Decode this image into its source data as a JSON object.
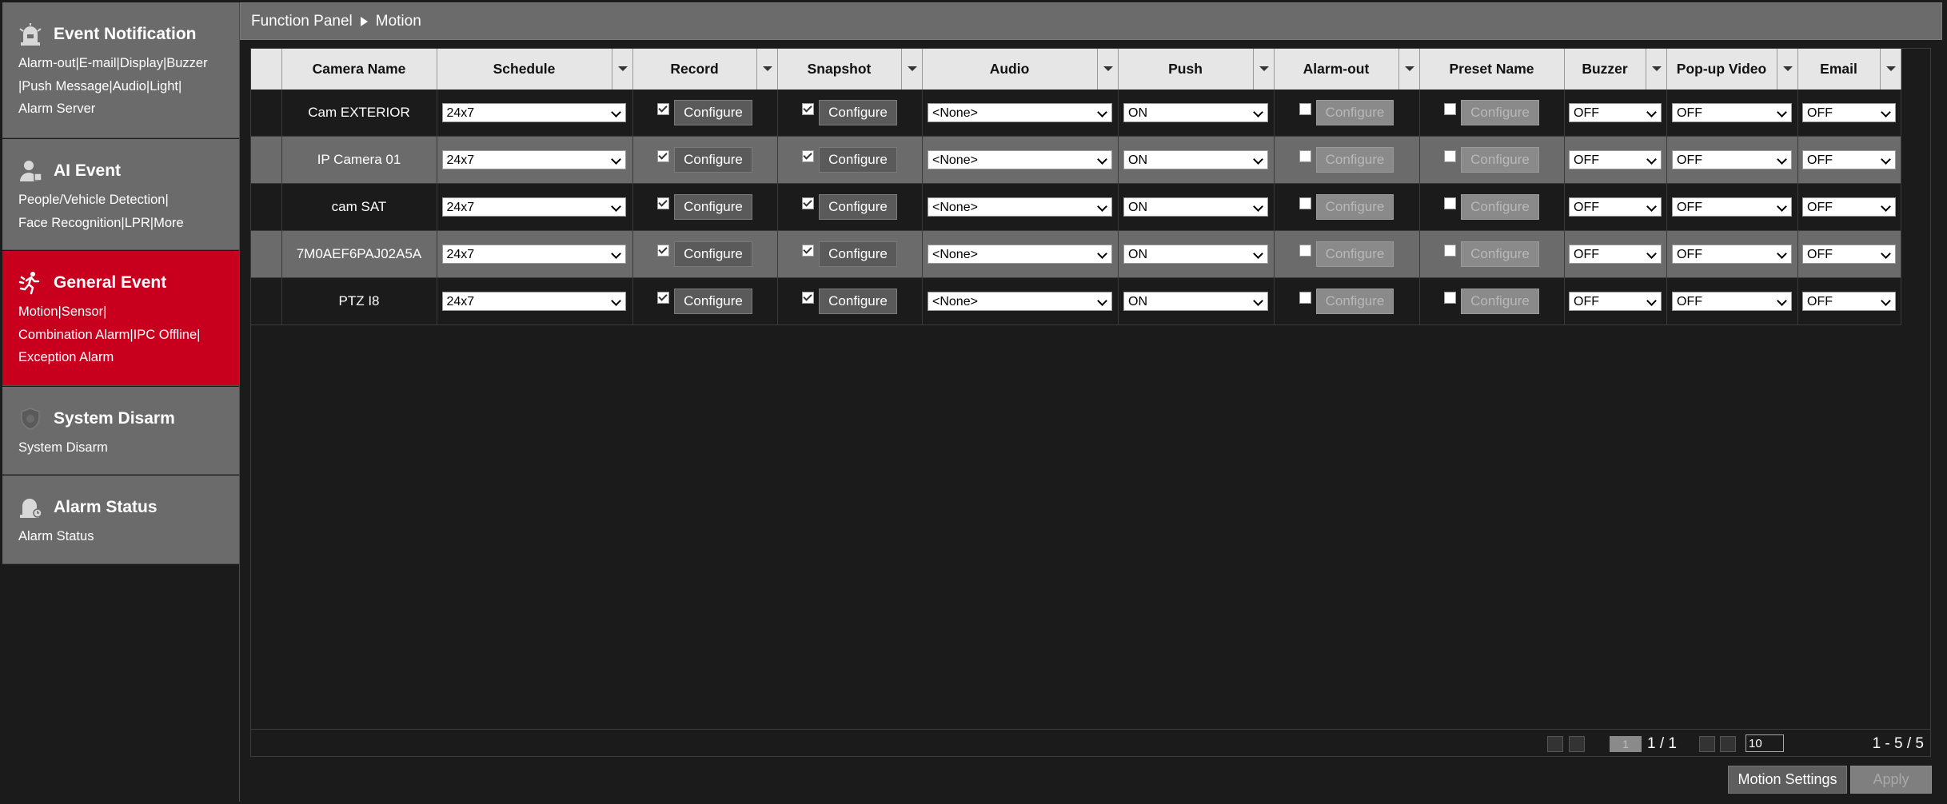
{
  "sidebar": {
    "sections": [
      {
        "title": "Event Notification",
        "links": [
          "Alarm-out|E-mail|Display|Buzzer",
          "|Push Message|Audio|Light|",
          "Alarm Server"
        ],
        "icon": "alarm-bell-icon"
      },
      {
        "title": "AI Event",
        "links": [
          "People/Vehicle Detection|",
          "Face Recognition|LPR|More"
        ],
        "icon": "ai-person-icon"
      },
      {
        "title": "General Event",
        "links": [
          "Motion|Sensor|",
          "Combination Alarm|IPC Offline|",
          "Exception Alarm"
        ],
        "icon": "running-person-icon",
        "active": true
      },
      {
        "title": "System Disarm",
        "links": [
          "System Disarm"
        ],
        "icon": "shield-icon"
      },
      {
        "title": "Alarm Status",
        "links": [
          "Alarm Status"
        ],
        "icon": "alarm-status-icon"
      }
    ],
    "active_color": "#c8001e"
  },
  "breadcrumb": {
    "root": "Function Panel",
    "current": "Motion"
  },
  "table": {
    "columns": [
      "Camera Name",
      "Schedule",
      "Record",
      "Snapshot",
      "Audio",
      "Push",
      "Alarm-out",
      "Preset Name",
      "Buzzer",
      "Pop-up Video",
      "Email"
    ],
    "configure_label": "Configure",
    "rows": [
      {
        "camera": "Cam EXTERIOR",
        "schedule": "24x7",
        "record": true,
        "snapshot": true,
        "audio": "<None>",
        "push": "ON",
        "alarm_out": false,
        "preset": false,
        "buzzer": "OFF",
        "popup": "OFF",
        "email": "OFF"
      },
      {
        "camera": "IP Camera 01",
        "schedule": "24x7",
        "record": true,
        "snapshot": true,
        "audio": "<None>",
        "push": "ON",
        "alarm_out": false,
        "preset": false,
        "buzzer": "OFF",
        "popup": "OFF",
        "email": "OFF"
      },
      {
        "camera": "cam SAT",
        "schedule": "24x7",
        "record": true,
        "snapshot": true,
        "audio": "<None>",
        "push": "ON",
        "alarm_out": false,
        "preset": false,
        "buzzer": "OFF",
        "popup": "OFF",
        "email": "OFF"
      },
      {
        "camera": "7M0AEF6PAJ02A5A",
        "schedule": "24x7",
        "record": true,
        "snapshot": true,
        "audio": "<None>",
        "push": "ON",
        "alarm_out": false,
        "preset": false,
        "buzzer": "OFF",
        "popup": "OFF",
        "email": "OFF"
      },
      {
        "camera": "PTZ I8",
        "schedule": "24x7",
        "record": true,
        "snapshot": true,
        "audio": "<None>",
        "push": "ON",
        "alarm_out": false,
        "preset": false,
        "buzzer": "OFF",
        "popup": "OFF",
        "email": "OFF"
      }
    ]
  },
  "pager": {
    "page_input": "1",
    "pages": "1 / 1",
    "page_size": "10",
    "range": "1 - 5 / 5"
  },
  "footer": {
    "motion_settings": "Motion Settings",
    "apply": "Apply"
  }
}
